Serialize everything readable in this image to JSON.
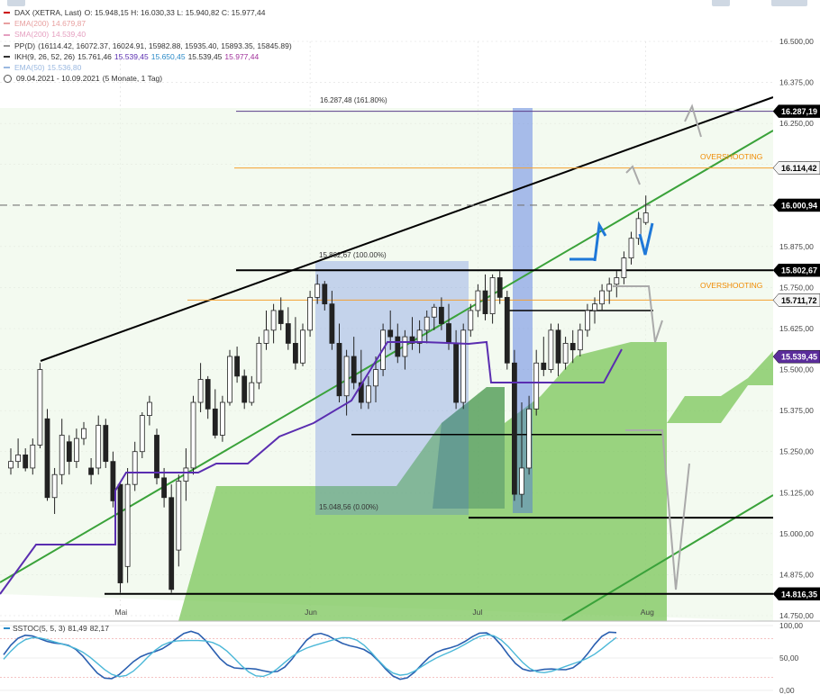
{
  "legend": {
    "title": "DAX (XETRA, Last)",
    "ohlc": "O: 15.948,15   H: 16.030,33   L: 15.940,82   C: 15.977,44",
    "ema200": "EMA(200)",
    "ema200_val": "14.679,87",
    "sma200": "SMA(200)",
    "sma200_val": "14.539,40",
    "pp": "PP(D)",
    "pp_vals": "(16114.42, 16072.37, 16024.91, 15982.88, 15935.40, 15893.35, 15845.89)",
    "ikh": "IKH(9, 26, 52, 26)",
    "ikh_v1": "15.761,46",
    "ikh_v2": "15.539,45",
    "ikh_v3": "15.650,45",
    "ikh_v4": "15.539,45",
    "ikh_v5": "15.977,44",
    "ema50": "EMA(50)",
    "ema50_val": "15.536,80",
    "range": "09.04.2021 - 10.09.2021",
    "range_note": "(5 Monate, 1 Tag)"
  },
  "sstoc": {
    "label": "SSTOC(5, 5, 3)",
    "v1": "81,49",
    "v2": "82,17"
  },
  "annotations": {
    "fib_top": "16.287,48 (161.80%)",
    "fib_mid": "15.802,67 (100.00%)",
    "fib_low": "15.048,56 (0.00%)",
    "overshoot1": "OVERSHOOTING",
    "overshoot2": "OVERSHOOTING"
  },
  "price_tags": [
    {
      "text": "16.287,19",
      "value": 16287.19,
      "bg": "#000000",
      "fg": "#ffffff"
    },
    {
      "text": "16.114,42",
      "value": 16114.42,
      "bg": "#f5f5f5",
      "fg": "#000000"
    },
    {
      "text": "16.000,94",
      "value": 16000.94,
      "bg": "#000000",
      "fg": "#ffffff"
    },
    {
      "text": "15.802,67",
      "value": 15802.67,
      "bg": "#000000",
      "fg": "#ffffff"
    },
    {
      "text": "15.711,72",
      "value": 15711.72,
      "bg": "#f5f5f5",
      "fg": "#000000"
    },
    {
      "text": "15.539,45",
      "value": 15539.45,
      "bg": "#5b2d9b",
      "fg": "#ffffff"
    },
    {
      "text": "14.816,35",
      "value": 14816.35,
      "bg": "#000000",
      "fg": "#ffffff"
    }
  ],
  "colors": {
    "bull_candle": "#ffffff",
    "bear_candle": "#222222",
    "kumo": "#7bc65a",
    "channel_green": "#3aa23a",
    "baseline": "#5a2db0",
    "fib_box": "#4a6fe0",
    "overshoot": "#f5a030",
    "grid": "#dddddd"
  },
  "chart_data": {
    "type": "candlestick",
    "ylim": [
      14750,
      16500
    ],
    "yticks": [
      "16.500,00",
      "16.375,00",
      "16.250,00",
      "16.125,00",
      "16.000,00",
      "15.875,00",
      "15.750,00",
      "15.625,00",
      "15.500,00",
      "15.375,00",
      "15.250,00",
      "15.125,00",
      "15.000,00",
      "14.875,00",
      "14.750,00"
    ],
    "ytick_values": [
      16500,
      16375,
      16250,
      16125,
      16000,
      15875,
      15750,
      15625,
      15500,
      15375,
      15250,
      15125,
      15000,
      14875,
      14750
    ],
    "months": [
      "Mai",
      "Jun",
      "Jul",
      "Aug"
    ],
    "month_day_index": [
      15,
      41,
      64,
      87
    ],
    "candles": [
      [
        15200,
        15260,
        15180,
        15220
      ],
      [
        15220,
        15290,
        15200,
        15240
      ],
      [
        15240,
        15260,
        15190,
        15200
      ],
      [
        15200,
        15290,
        15180,
        15270
      ],
      [
        15270,
        15520,
        15260,
        15500
      ],
      [
        15350,
        15380,
        15100,
        15110
      ],
      [
        15110,
        15200,
        15060,
        15180
      ],
      [
        15180,
        15350,
        15150,
        15300
      ],
      [
        15280,
        15300,
        15180,
        15220
      ],
      [
        15220,
        15320,
        15200,
        15290
      ],
      [
        15290,
        15340,
        15270,
        15320
      ],
      [
        15200,
        15230,
        15150,
        15180
      ],
      [
        15200,
        15360,
        15180,
        15330
      ],
      [
        15330,
        15350,
        15200,
        15220
      ],
      [
        15220,
        15250,
        15080,
        15100
      ],
      [
        15150,
        15160,
        14820,
        14850
      ],
      [
        14900,
        15200,
        14850,
        15150
      ],
      [
        15150,
        15280,
        15130,
        15250
      ],
      [
        15250,
        15370,
        15230,
        15360
      ],
      [
        15360,
        15420,
        15330,
        15400
      ],
      [
        15300,
        15320,
        15150,
        15170
      ],
      [
        15170,
        15200,
        15080,
        15110
      ],
      [
        15110,
        15150,
        14820,
        14830
      ],
      [
        14950,
        15180,
        14900,
        15160
      ],
      [
        15160,
        15260,
        15100,
        15200
      ],
      [
        15200,
        15420,
        15180,
        15400
      ],
      [
        15400,
        15520,
        15370,
        15470
      ],
      [
        15470,
        15480,
        15350,
        15380
      ],
      [
        15380,
        15440,
        15290,
        15300
      ],
      [
        15300,
        15420,
        15280,
        15400
      ],
      [
        15400,
        15560,
        15390,
        15540
      ],
      [
        15540,
        15570,
        15460,
        15480
      ],
      [
        15480,
        15500,
        15380,
        15400
      ],
      [
        15400,
        15480,
        15390,
        15460
      ],
      [
        15460,
        15600,
        15440,
        15580
      ],
      [
        15580,
        15680,
        15560,
        15620
      ],
      [
        15620,
        15700,
        15580,
        15680
      ],
      [
        15680,
        15720,
        15620,
        15640
      ],
      [
        15640,
        15690,
        15560,
        15580
      ],
      [
        15580,
        15660,
        15500,
        15520
      ],
      [
        15520,
        15640,
        15510,
        15620
      ],
      [
        15620,
        15740,
        15600,
        15720
      ],
      [
        15720,
        15790,
        15700,
        15760
      ],
      [
        15760,
        15770,
        15680,
        15700
      ],
      [
        15700,
        15740,
        15560,
        15580
      ],
      [
        15580,
        15640,
        15400,
        15420
      ],
      [
        15420,
        15560,
        15360,
        15540
      ],
      [
        15540,
        15600,
        15440,
        15460
      ],
      [
        15460,
        15560,
        15380,
        15400
      ],
      [
        15400,
        15480,
        15380,
        15450
      ],
      [
        15450,
        15540,
        15400,
        15500
      ],
      [
        15500,
        15640,
        15480,
        15620
      ],
      [
        15620,
        15680,
        15560,
        15600
      ],
      [
        15600,
        15640,
        15520,
        15540
      ],
      [
        15540,
        15620,
        15500,
        15600
      ],
      [
        15600,
        15660,
        15560,
        15580
      ],
      [
        15580,
        15650,
        15550,
        15620
      ],
      [
        15620,
        15680,
        15580,
        15660
      ],
      [
        15660,
        15700,
        15620,
        15690
      ],
      [
        15690,
        15720,
        15620,
        15640
      ],
      [
        15640,
        15700,
        15560,
        15580
      ],
      [
        15580,
        15620,
        15380,
        15400
      ],
      [
        15400,
        15640,
        15380,
        15620
      ],
      [
        15620,
        15700,
        15600,
        15680
      ],
      [
        15680,
        15760,
        15660,
        15740
      ],
      [
        15740,
        15790,
        15650,
        15670
      ],
      [
        15670,
        15790,
        15640,
        15780
      ],
      [
        15780,
        15800,
        15700,
        15720
      ],
      [
        15720,
        15740,
        15500,
        15520
      ],
      [
        15520,
        15560,
        15100,
        15120
      ],
      [
        15120,
        15400,
        15080,
        15200
      ],
      [
        15200,
        15420,
        15180,
        15380
      ],
      [
        15380,
        15560,
        15360,
        15520
      ],
      [
        15520,
        15600,
        15480,
        15500
      ],
      [
        15500,
        15640,
        15490,
        15620
      ],
      [
        15620,
        15640,
        15480,
        15520
      ],
      [
        15520,
        15600,
        15500,
        15580
      ],
      [
        15580,
        15620,
        15520,
        15560
      ],
      [
        15560,
        15640,
        15540,
        15620
      ],
      [
        15620,
        15700,
        15600,
        15680
      ],
      [
        15680,
        15720,
        15640,
        15700
      ],
      [
        15700,
        15760,
        15680,
        15740
      ],
      [
        15740,
        15780,
        15700,
        15760
      ],
      [
        15760,
        15800,
        15720,
        15780
      ],
      [
        15780,
        15860,
        15760,
        15840
      ],
      [
        15840,
        15920,
        15820,
        15900
      ],
      [
        15900,
        15980,
        15880,
        15960
      ],
      [
        15948.15,
        16030.33,
        15940.82,
        15977.44
      ]
    ]
  }
}
